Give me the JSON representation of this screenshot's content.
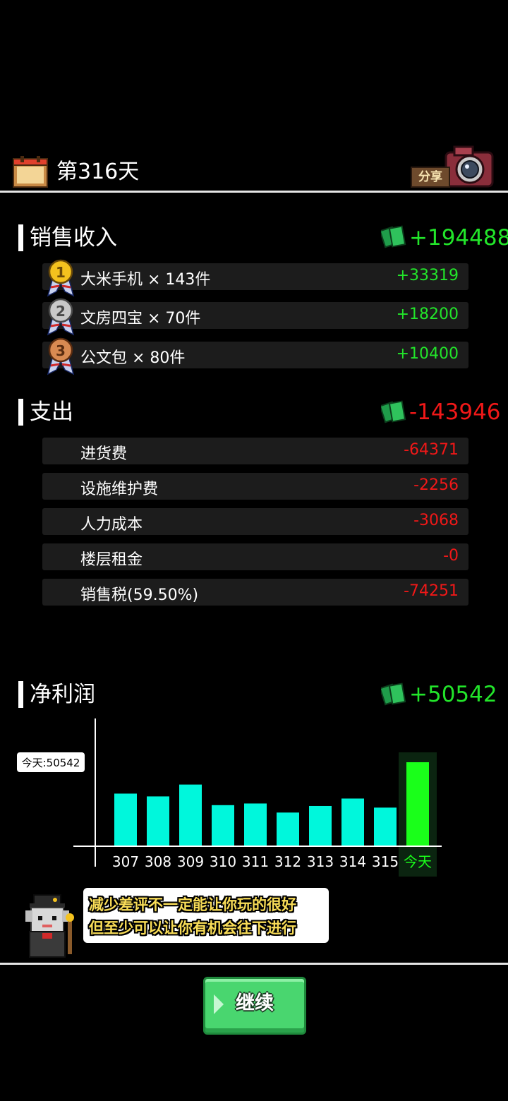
{
  "header": {
    "calendar_icon": "calendar-icon",
    "day_title": "第316天",
    "share_label": "分享",
    "share_icon": "camera-icon"
  },
  "sales": {
    "title": "销售收入",
    "total": "+194488",
    "items": [
      {
        "rank": "1",
        "name": "大米手机 × 143件",
        "value": "+33319",
        "medal": "gold-medal-icon"
      },
      {
        "rank": "2",
        "name": "文房四宝 × 70件",
        "value": "+18200",
        "medal": "silver-medal-icon"
      },
      {
        "rank": "3",
        "name": "公文包 × 80件",
        "value": "+10400",
        "medal": "bronze-medal-icon"
      }
    ]
  },
  "expense": {
    "title": "支出",
    "total": "-143946",
    "items": [
      {
        "name": "进货费",
        "value": "-64371"
      },
      {
        "name": "设施维护费",
        "value": "-2256"
      },
      {
        "name": "人力成本",
        "value": "-3068"
      },
      {
        "name": "楼层租金",
        "value": "-0"
      },
      {
        "name": "销售税(59.50%)",
        "value": "-74251"
      }
    ]
  },
  "profit": {
    "title": "净利润",
    "total": "+50542"
  },
  "chart_data": {
    "type": "bar",
    "categories": [
      "307",
      "308",
      "309",
      "310",
      "311",
      "312",
      "313",
      "314",
      "315",
      "今天"
    ],
    "values": [
      31500,
      29800,
      37000,
      24500,
      25500,
      20000,
      24000,
      28500,
      23000,
      50542
    ],
    "today_label": "今天:50542",
    "highlight_index": 9,
    "colors": {
      "normal": "#00f7dc",
      "highlight": "#1aff1a",
      "highlight_bg": "#0b2410"
    },
    "ylim": [
      0,
      50542
    ]
  },
  "tip": {
    "line1": "减少差评不一定能让你玩的很好",
    "line2": "但至少可以让你有机会往下进行",
    "mascot_icon": "cat-mascot-icon"
  },
  "continue_label": "继续",
  "colors": {
    "positive": "#22e52a",
    "negative": "#f01818",
    "row_bg": "#1c1c1c"
  }
}
